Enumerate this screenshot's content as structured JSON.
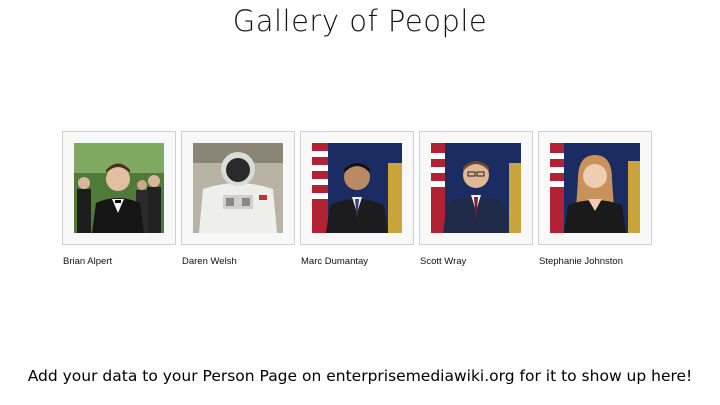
{
  "page": {
    "title": "Gallery of People",
    "footer": "Add your data to your Person Page on enterprisemediawiki.org for it to show up here!"
  },
  "people": [
    {
      "name": "Brian Alpert",
      "photo": "person-photo"
    },
    {
      "name": "Daren Welsh",
      "photo": "astronaut-photo"
    },
    {
      "name": "Marc Dumantay",
      "photo": "person-photo"
    },
    {
      "name": "Scott Wray",
      "photo": "person-photo"
    },
    {
      "name": "Stephanie Johnston",
      "photo": "person-photo"
    }
  ],
  "colors": {
    "frame_border": "#cfcfcf",
    "frame_bg": "#f8f8f8",
    "portrait_bg": "#1a2a5c",
    "outdoor_bg": "#3e6b2e"
  }
}
